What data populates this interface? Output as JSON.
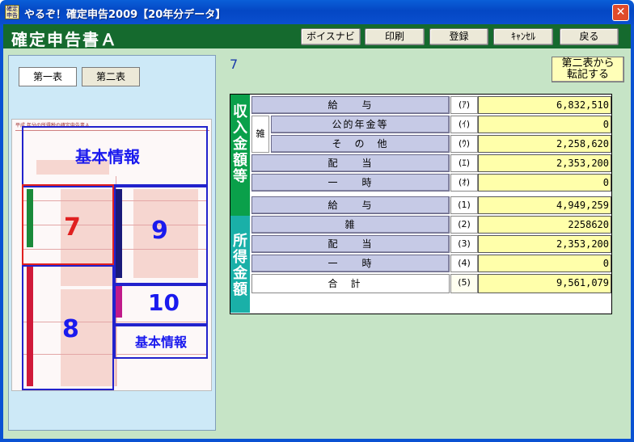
{
  "window": {
    "title": "やるぞ！確定申告2009【20年分データ】",
    "icon_text": "確定申告",
    "close_glyph": "✕"
  },
  "header": {
    "title": "確定申告書Ａ",
    "buttons": {
      "voice": "ボイスナビ",
      "print": "印刷",
      "register": "登録",
      "cancel": "ｷｬﾝｾﾙ",
      "back": "戻る"
    }
  },
  "left": {
    "tabs": {
      "first": "第一表",
      "second": "第二表"
    },
    "form": {
      "header_text": "平成 年分の所得税の確定申告書Ａ",
      "regions": {
        "basic_top": "基本情報",
        "r7": "7",
        "r9": "9",
        "r10": "10",
        "r8": "8",
        "basic_bottom": "基本情報"
      }
    }
  },
  "right": {
    "section_number": "7",
    "transfer_button": {
      "line1": "第二表から",
      "line2": "転記する"
    },
    "groups": {
      "income": "収入金額等",
      "shotoku": "所得金額"
    },
    "zatsu": "雑",
    "rows": [
      {
        "label": "給　　与",
        "code": "(ｱ)",
        "value": "6,832,510"
      },
      {
        "label": "公的年金等",
        "code": "(ｲ)",
        "value": "0"
      },
      {
        "label": "そ　の　他",
        "code": "(ｳ)",
        "value": "2,258,620"
      },
      {
        "label": "配　　当",
        "code": "(ｴ)",
        "value": "2,353,200"
      },
      {
        "label": "一　　時",
        "code": "(ｵ)",
        "value": "0"
      },
      {
        "label": "給　　与",
        "code": "(1)",
        "value": "4,949,259"
      },
      {
        "label": "雑",
        "code": "(2)",
        "value": "2258620"
      },
      {
        "label": "配　　当",
        "code": "(3)",
        "value": "2,353,200"
      },
      {
        "label": "一　　時",
        "code": "(4)",
        "value": "0"
      }
    ],
    "total": {
      "label": "合計",
      "code": "(5)",
      "value": "9,561,079"
    }
  }
}
